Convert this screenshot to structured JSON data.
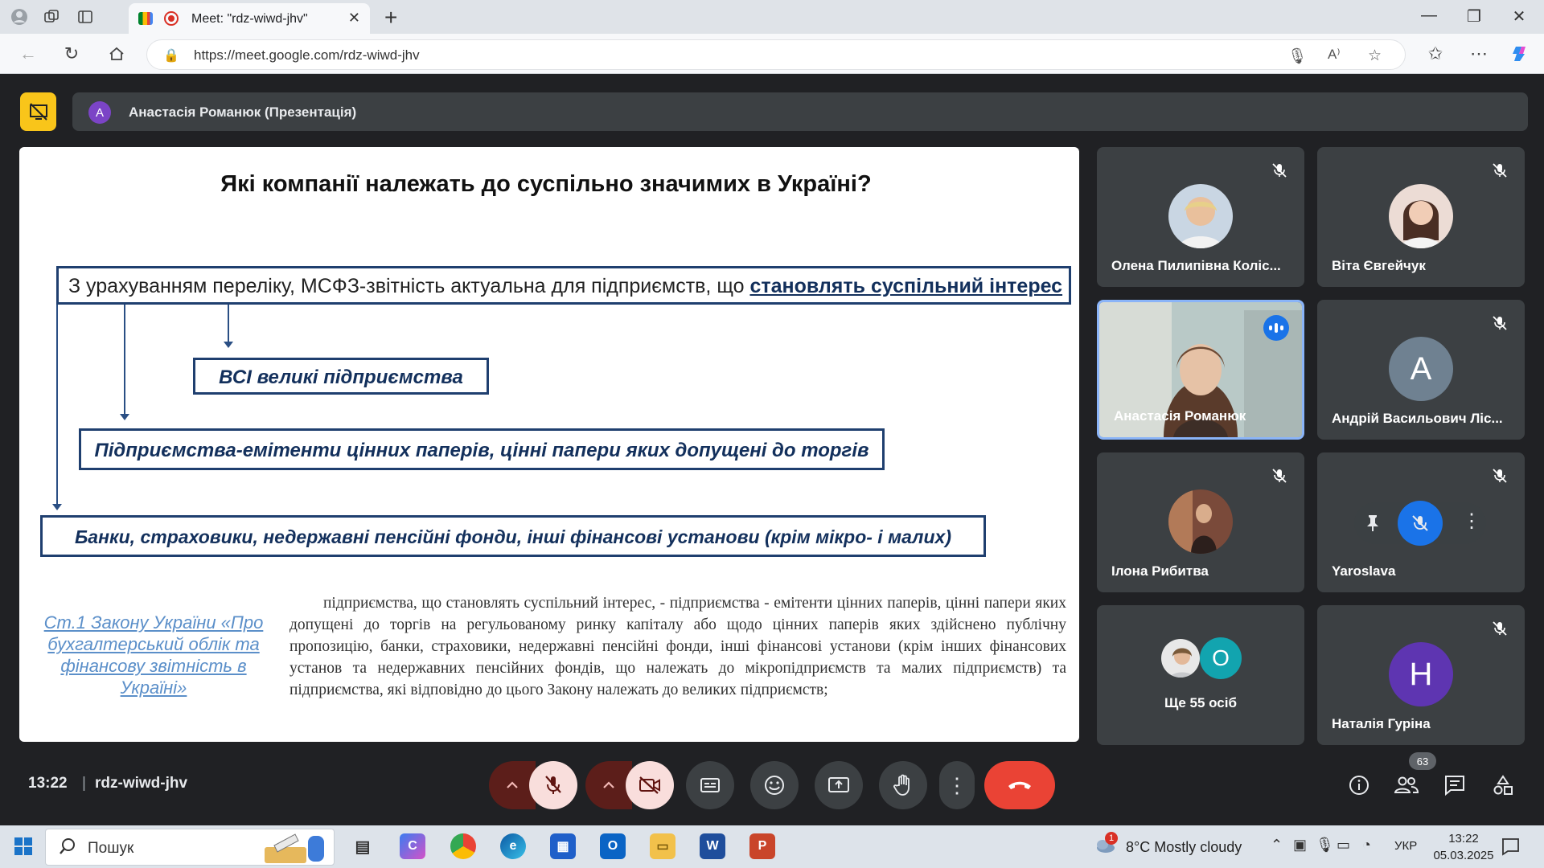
{
  "browser": {
    "tab_title": "Meet: \"rdz-wiwd-jhv\"",
    "url": "https://meet.google.com/rdz-wiwd-jhv"
  },
  "meet": {
    "presenter_initial": "A",
    "presenter_label": "Анастасія Романюк (Презентація)",
    "time": "13:22",
    "separator": "|",
    "meeting_code": "rdz-wiwd-jhv",
    "participant_count": "63"
  },
  "slide": {
    "title": "Які компанії належать до суспільно значимих в Україні?",
    "box1_text": "З урахуванням переліку, МСФЗ-звітність актуальна для підприємств, що ",
    "box1_emphasis": "становлять суспільний інтерес",
    "box2": "ВСІ великі підприємства",
    "box3": "Підприємства-емітенти цінних паперів, цінні папери яких допущені до торгів",
    "box4": "Банки, страховики, недержавні пенсійні фонди, інші фінансові установи (крім мікро- і малих)",
    "law_link": "Ст.1 Закону України «Про бухгалтерський облік та фінансову звітність в Україні»",
    "law_text": "підприємства, що становлять суспільний інтерес, - підприємства - емітенти цінних паперів, цінні папери яких допущені до торгів на регульованому ринку капіталу або щодо цінних паперів яких здійснено публічну пропозицію, банки, страховики, недержавні пенсійні фонди, інші фінансові установи (крім інших фінансових установ та недержавних пенсійних фондів, що належать до мікропідприємств та малих підприємств) та підприємства, які відповідно до цього Закону належать до великих підприємств;"
  },
  "participants": [
    {
      "name": "Олена Пилипівна Коліс..."
    },
    {
      "name": "Віта Євгейчук"
    },
    {
      "name": "Анастасія Романюк"
    },
    {
      "name": "Андрій Васильович Ліс...",
      "initial": "А"
    },
    {
      "name": "Ілона Рибитва"
    },
    {
      "name": "Yaroslava"
    },
    {
      "name": "Ще 55 осіб",
      "initial": "О"
    },
    {
      "name": "Наталія Гуріна",
      "initial": "Н"
    }
  ],
  "taskbar": {
    "search_label": "Пошук",
    "weather_badge": "1",
    "weather": "8°C  Mostly cloudy",
    "lang": "УКР",
    "clock_time": "13:22",
    "clock_date": "05.03.2025"
  },
  "colors": {
    "present_accent": "#f9c51a",
    "end_call": "#ea4335",
    "muted_bg": "#f9dedc",
    "slide_border": "#1f3f6f"
  }
}
